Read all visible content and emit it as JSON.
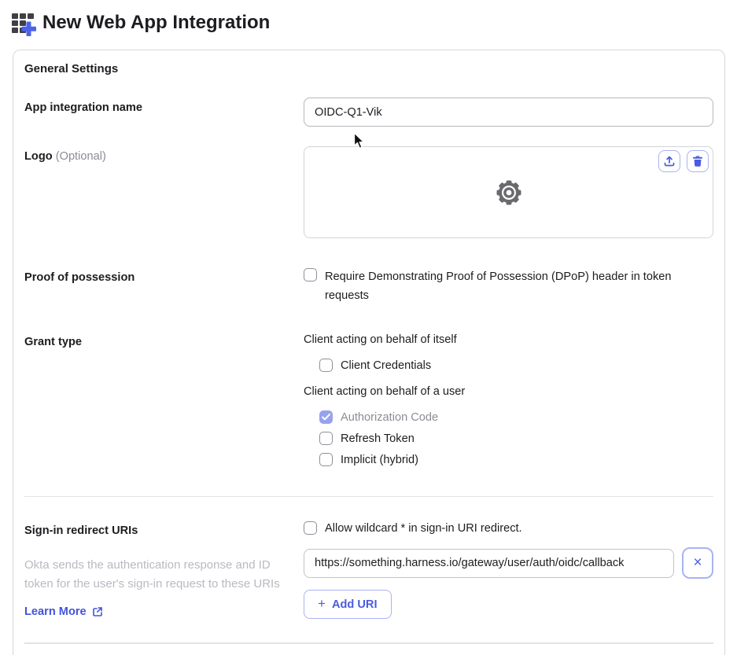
{
  "colors": {
    "accent_blue": "#4a5ce0",
    "accent_border": "#a9b3f3",
    "checked_checkbox_fill": "#97a2ee",
    "text_primary": "#1d1d21",
    "text_muted": "#8c8c96",
    "helper_gray": "#b9b9c1"
  },
  "header": {
    "title": "New Web App Integration",
    "icon": "app-grid-plus-icon"
  },
  "card": {
    "section_title": "General Settings",
    "app_name": {
      "label": "App integration name",
      "value": "OIDC-Q1-Vik"
    },
    "logo": {
      "label": "Logo",
      "optional": "(Optional)",
      "icons": {
        "placeholder": "gear-icon",
        "upload": "upload-icon",
        "delete": "trash-icon"
      }
    },
    "dpop": {
      "label": "Proof of possession",
      "option": "Require Demonstrating Proof of Possession (DPoP) header in token requests",
      "checked": false
    },
    "grant_type": {
      "label": "Grant type",
      "groups": [
        {
          "heading": "Client acting on behalf of itself",
          "options": [
            {
              "label": "Client Credentials",
              "checked": false,
              "disabled": false
            }
          ]
        },
        {
          "heading": "Client acting on behalf of a user",
          "options": [
            {
              "label": "Authorization Code",
              "checked": true,
              "disabled": true
            },
            {
              "label": "Refresh Token",
              "checked": false,
              "disabled": false
            },
            {
              "label": "Implicit (hybrid)",
              "checked": false,
              "disabled": false
            }
          ]
        }
      ]
    },
    "redirect": {
      "label": "Sign-in redirect URIs",
      "wildcard_option": "Allow wildcard * in sign-in URI redirect.",
      "helper": "Okta sends the authentication response and ID token for the user's sign-in request to these URIs",
      "learn_more_label": "Learn More",
      "uris": [
        "https://something.harness.io/gateway/user/auth/oidc/callback"
      ],
      "remove_uri_glyph": "×",
      "add_uri": {
        "plus": "+",
        "label": "Add URI"
      }
    }
  }
}
